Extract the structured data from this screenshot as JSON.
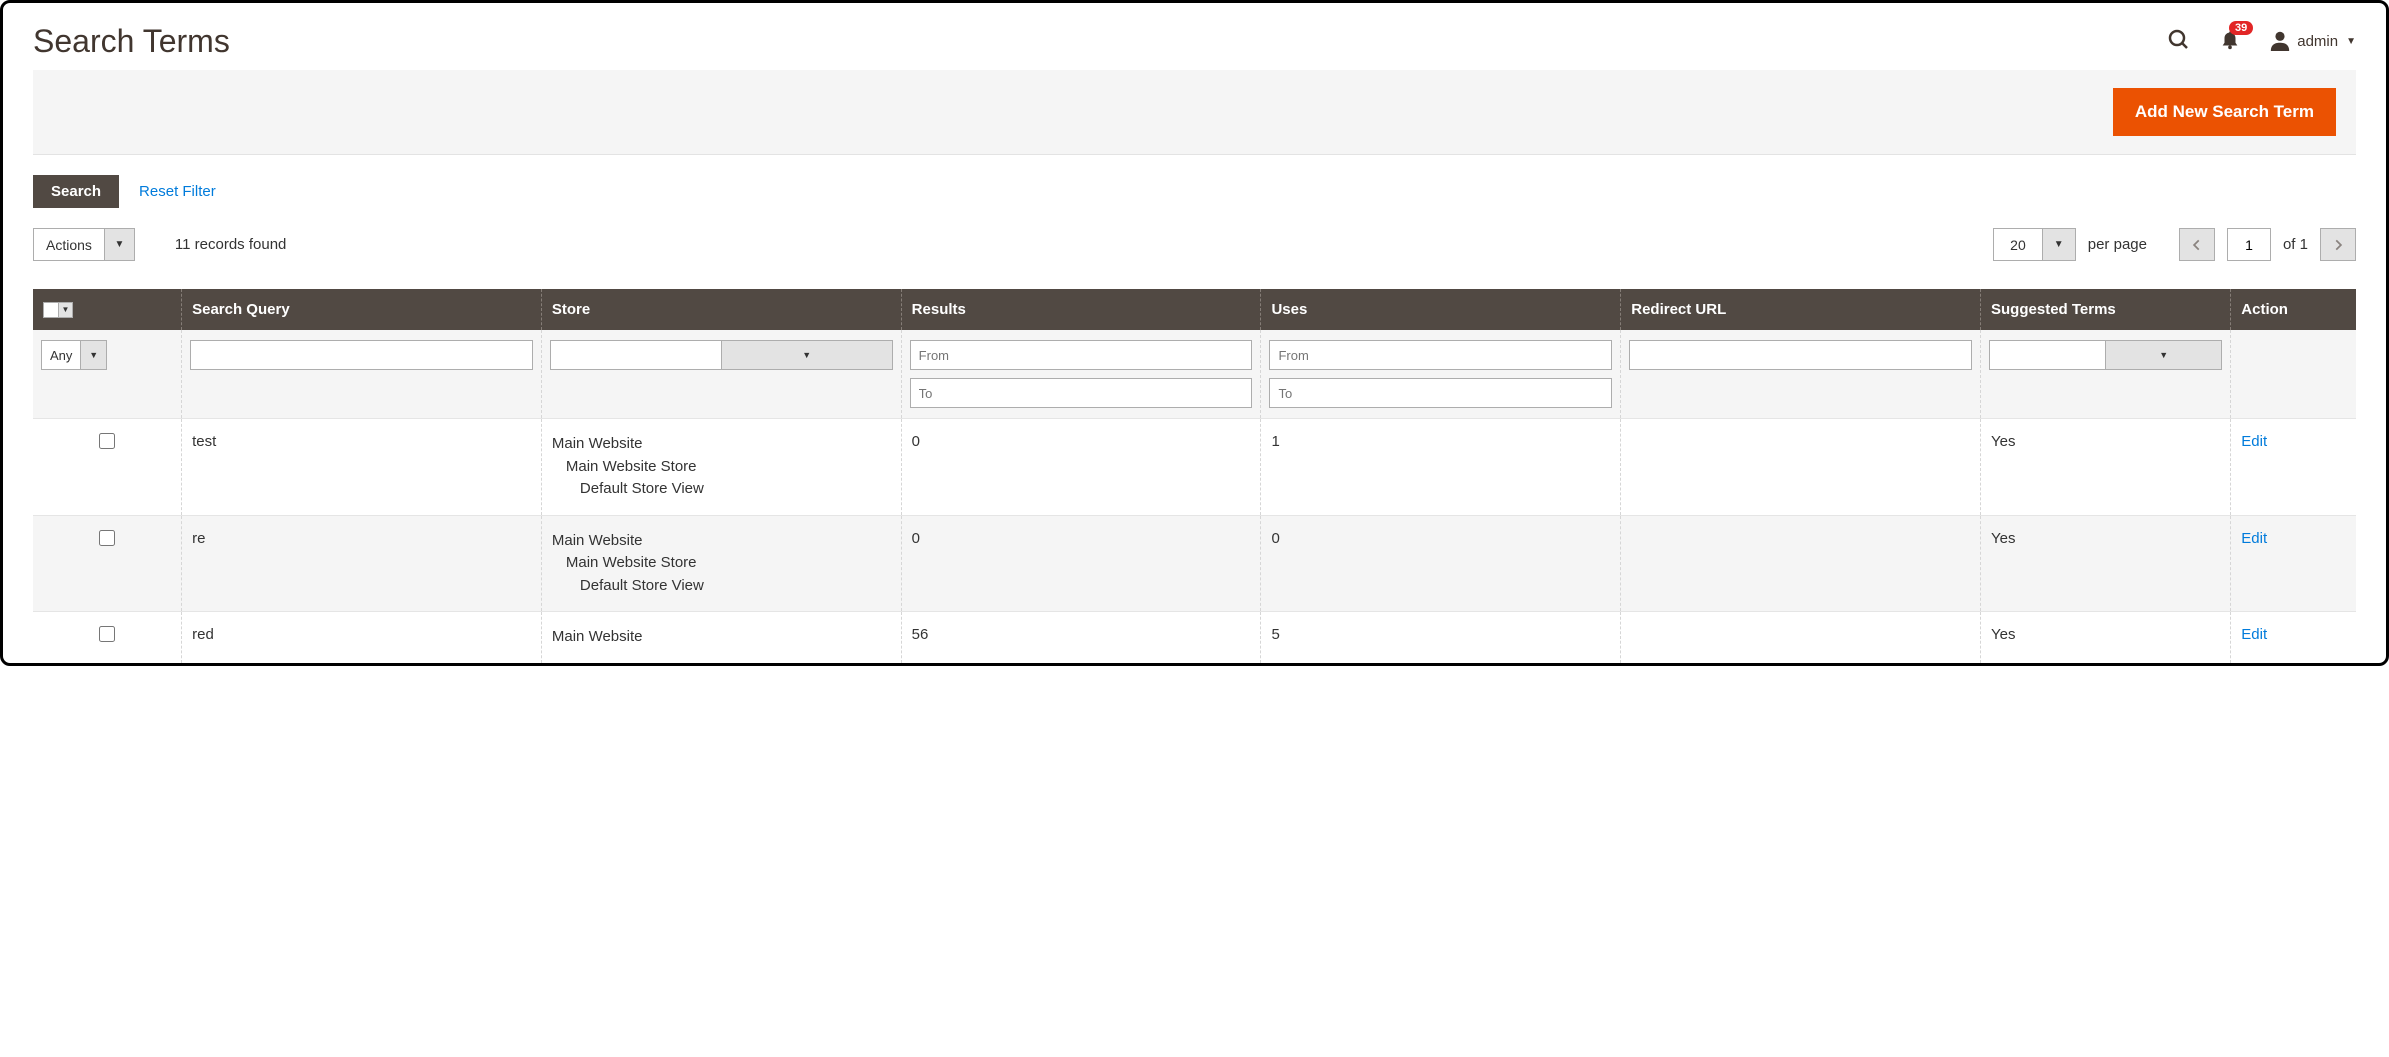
{
  "header": {
    "title": "Search Terms",
    "badge_count": "39",
    "account_name": "admin"
  },
  "toolbar": {
    "add_button": "Add New Search Term"
  },
  "controls": {
    "search_btn": "Search",
    "reset_filter": "Reset Filter",
    "actions_label": "Actions",
    "records_found": "11 records found",
    "per_page_value": "20",
    "per_page_label": "per page",
    "page_current": "1",
    "page_of": "of 1"
  },
  "columns": {
    "check": "",
    "search_query": "Search Query",
    "store": "Store",
    "results": "Results",
    "uses": "Uses",
    "redirect_url": "Redirect URL",
    "suggested": "Suggested Terms",
    "action": "Action"
  },
  "filters": {
    "any": "Any",
    "from": "From",
    "to": "To"
  },
  "store_labels": {
    "website": "Main Website",
    "store": "Main Website Store",
    "view": "Default Store View"
  },
  "rows": [
    {
      "query": "test",
      "results": "0",
      "uses": "1",
      "redirect": "",
      "suggested": "Yes",
      "action": "Edit"
    },
    {
      "query": "re",
      "results": "0",
      "uses": "0",
      "redirect": "",
      "suggested": "Yes",
      "action": "Edit"
    },
    {
      "query": "red",
      "results": "56",
      "uses": "5",
      "redirect": "",
      "suggested": "Yes",
      "action": "Edit"
    }
  ]
}
